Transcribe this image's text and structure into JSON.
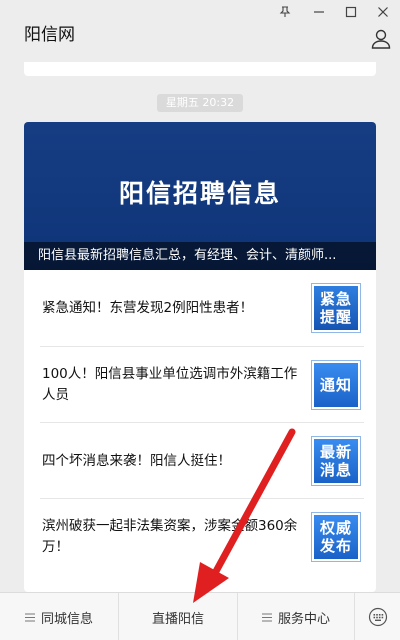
{
  "window": {
    "title": "阳信网",
    "icons": [
      "pin-icon",
      "minimize-icon",
      "maximize-icon",
      "close-icon",
      "user-icon"
    ]
  },
  "chat": {
    "timestamp": "星期五  20:32"
  },
  "article": {
    "hero_title": "阳信招聘信息",
    "hero_caption": "阳信县最新招聘信息汇总，有经理、会计、清颜师...",
    "items": [
      {
        "text": "紧急通知！东营发现2例阳性患者！",
        "thumb_line1": "紧急",
        "thumb_line2": "提醒"
      },
      {
        "text": "100人！阳信县事业单位选调市外滨籍工作人员",
        "thumb_line1": "通知",
        "thumb_line2": ""
      },
      {
        "text": "四个坏消息来袭！阳信人挺住！",
        "thumb_line1": "最新",
        "thumb_line2": "消息"
      },
      {
        "text": "滨州破获一起非法集资案，涉案金额360余万！",
        "thumb_line1": "权威",
        "thumb_line2": "发布"
      }
    ]
  },
  "menu": {
    "items": [
      {
        "label": "同城信息"
      },
      {
        "label": "直播阳信"
      },
      {
        "label": "服务中心"
      }
    ]
  },
  "colors": {
    "hero_bg": "#163d83",
    "thumb_bg": "#1f6fd6",
    "arrow": "#e02020"
  }
}
